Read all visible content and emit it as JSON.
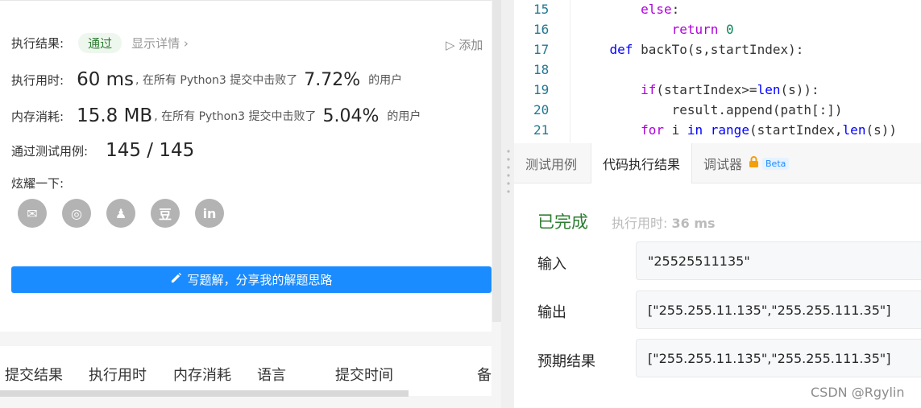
{
  "result": {
    "label": "执行结果:",
    "status": "通过",
    "details": "显示详情 ›",
    "add_note": "▷ 添加"
  },
  "runtime": {
    "label": "执行用时:",
    "value": "60 ms",
    "mid": ", 在所有 Python3 提交中击败了",
    "pct": "7.72%",
    "tail": "的用户"
  },
  "memory": {
    "label": "内存消耗:",
    "value": "15.8 MB",
    "mid": ", 在所有 Python3 提交中击败了",
    "pct": "5.04%",
    "tail": "的用户"
  },
  "tests": {
    "label": "通过测试用例:",
    "value": "145 / 145"
  },
  "share": {
    "label": "炫耀一下:",
    "icons": [
      {
        "name": "wechat-icon",
        "glyph": "✉"
      },
      {
        "name": "weibo-icon",
        "glyph": "◎"
      },
      {
        "name": "qq-icon",
        "glyph": "♟"
      },
      {
        "name": "douban-icon",
        "glyph": "豆"
      },
      {
        "name": "linkedin-icon",
        "glyph": "in"
      }
    ]
  },
  "write_button": "写题解，分享我的解题思路",
  "table_headers": [
    "提交结果",
    "执行用时",
    "内存消耗",
    "语言",
    "提交时间",
    "备"
  ],
  "code": {
    "lines": [
      {
        "n": "15",
        "parts": [
          {
            "t": "        "
          },
          {
            "t": "else",
            "c": "kw2"
          },
          {
            "t": ":"
          }
        ]
      },
      {
        "n": "16",
        "parts": [
          {
            "t": "            "
          },
          {
            "t": "return",
            "c": "kw2"
          },
          {
            "t": " "
          },
          {
            "t": "0",
            "c": "num"
          }
        ]
      },
      {
        "n": "17",
        "parts": [
          {
            "t": "    "
          },
          {
            "t": "def",
            "c": "kw"
          },
          {
            "t": " backTo(s,startIndex):"
          }
        ]
      },
      {
        "n": "18",
        "parts": [
          {
            "t": ""
          }
        ]
      },
      {
        "n": "19",
        "parts": [
          {
            "t": "        "
          },
          {
            "t": "if",
            "c": "kw2"
          },
          {
            "t": "(startIndex>="
          },
          {
            "t": "len",
            "c": "kw"
          },
          {
            "t": "(s)):"
          }
        ]
      },
      {
        "n": "20",
        "parts": [
          {
            "t": "            result.append(path[:])"
          }
        ]
      },
      {
        "n": "21",
        "parts": [
          {
            "t": "        "
          },
          {
            "t": "for",
            "c": "kw2"
          },
          {
            "t": " i "
          },
          {
            "t": "in",
            "c": "kw"
          },
          {
            "t": " "
          },
          {
            "t": "range",
            "c": "kw"
          },
          {
            "t": "(startIndex,"
          },
          {
            "t": "len",
            "c": "kw"
          },
          {
            "t": "(s))"
          }
        ]
      }
    ]
  },
  "tabs": {
    "testcase": "测试用例",
    "result": "代码执行结果",
    "debugger": "调试器",
    "beta": "Beta"
  },
  "run": {
    "status": "已完成",
    "time_label": "执行用时:",
    "time_value": "36 ms",
    "input_label": "输入",
    "input_value": "\"25525511135\"",
    "output_label": "输出",
    "output_value": "[\"255.255.11.135\",\"255.255.111.35\"]",
    "expected_label": "预期结果",
    "expected_value": "[\"255.255.11.135\",\"255.255.111.35\"]"
  },
  "watermark": "CSDN @Rgylin"
}
